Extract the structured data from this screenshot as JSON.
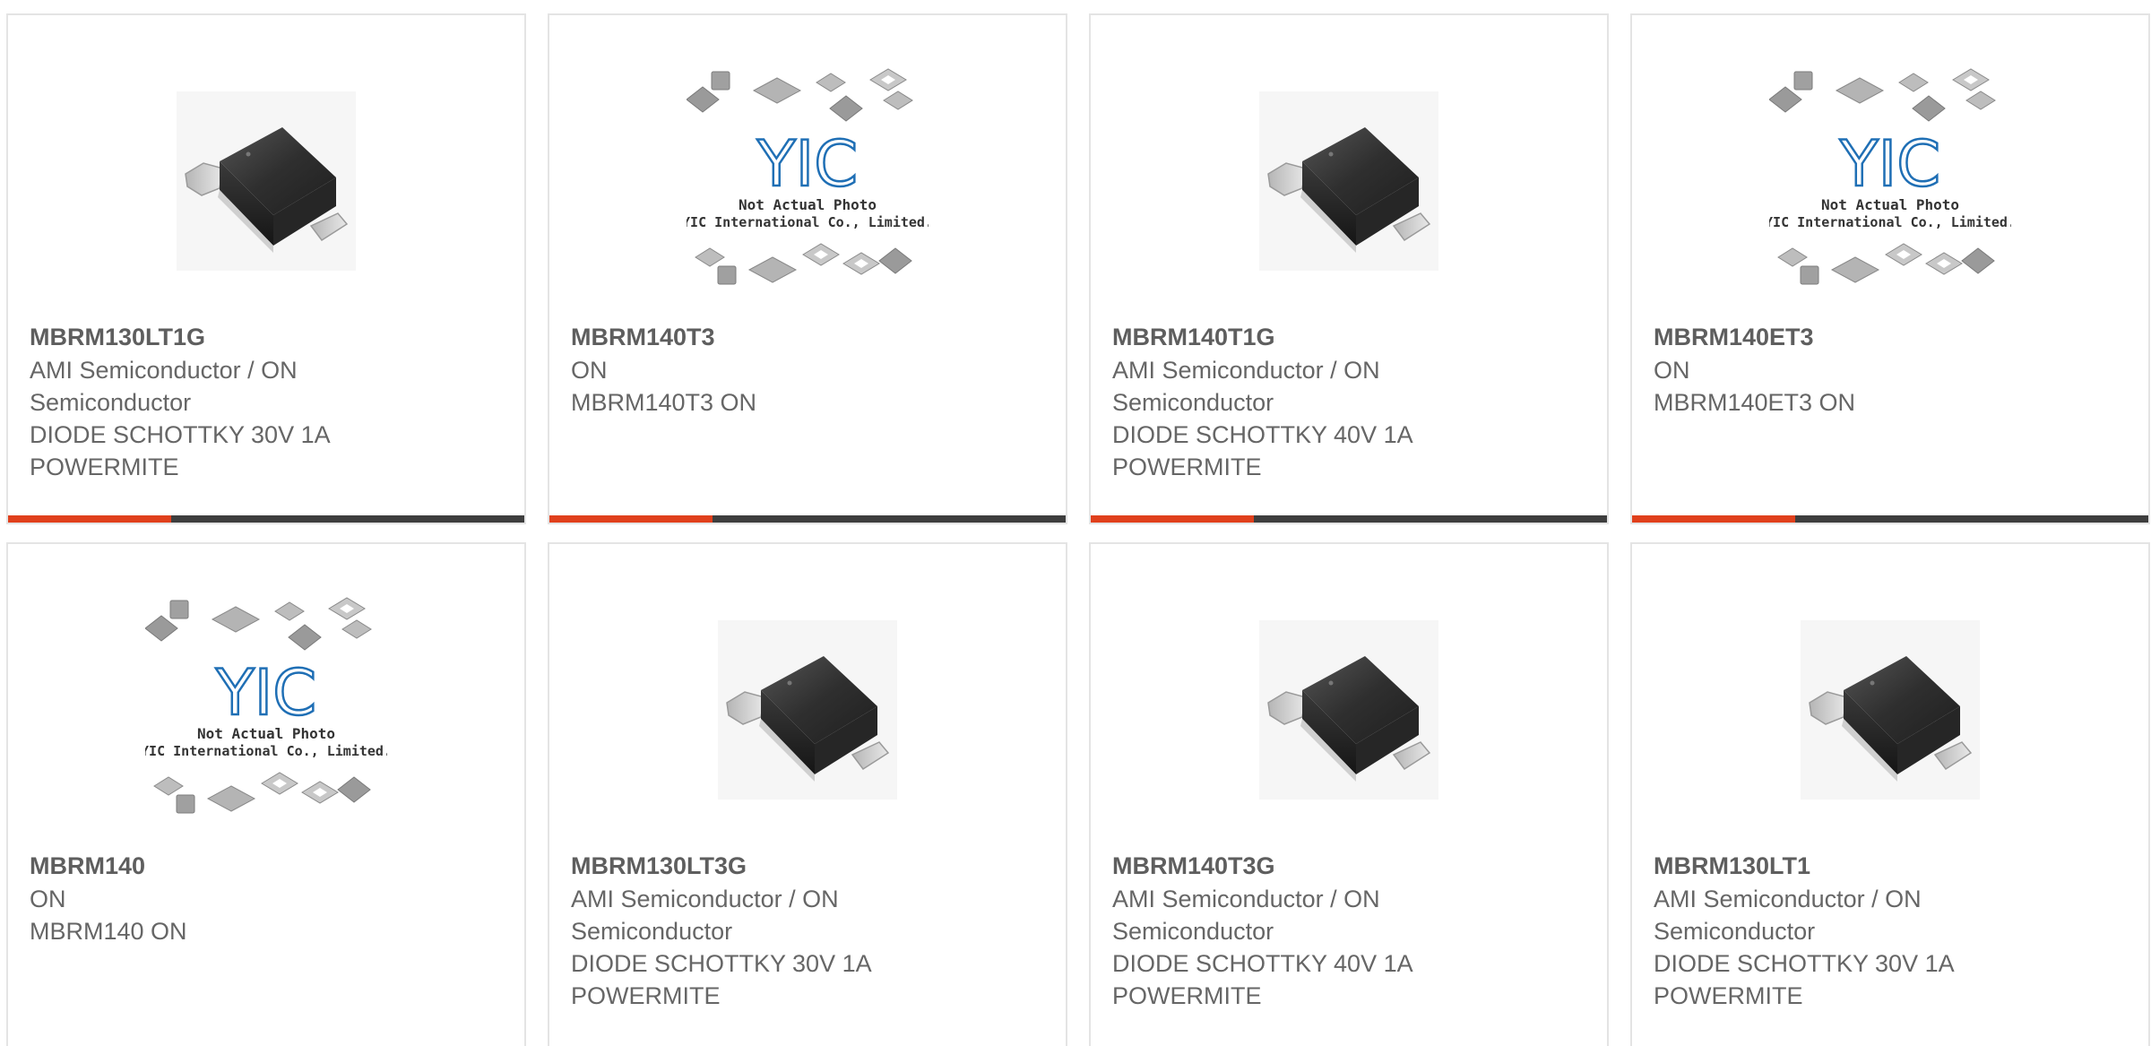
{
  "colors": {
    "accent": "#e0401c",
    "bar": "#3e3e3e",
    "border": "#e4e4e4",
    "text": "#666666"
  },
  "placeholder": {
    "line1": "Not Actual Photo",
    "line2": "YIC International Co., Limited.",
    "logo": "YIC"
  },
  "cards": [
    {
      "part": "MBRM130LT1G",
      "mfr_line1": "AMI Semiconductor / ON",
      "mfr_line2": "Semiconductor",
      "desc_line1": "DIODE SCHOTTKY 30V 1A",
      "desc_line2": "POWERMITE",
      "image": "diode-photo"
    },
    {
      "part": "MBRM140T3",
      "mfr_line1": "ON",
      "mfr_line2": "",
      "desc_line1": "MBRM140T3 ON",
      "desc_line2": "",
      "image": "placeholder"
    },
    {
      "part": "MBRM140T1G",
      "mfr_line1": "AMI Semiconductor / ON",
      "mfr_line2": "Semiconductor",
      "desc_line1": "DIODE SCHOTTKY 40V 1A",
      "desc_line2": "POWERMITE",
      "image": "diode-photo"
    },
    {
      "part": "MBRM140ET3",
      "mfr_line1": "ON",
      "mfr_line2": "",
      "desc_line1": "MBRM140ET3 ON",
      "desc_line2": "",
      "image": "placeholder"
    },
    {
      "part": "MBRM140",
      "mfr_line1": "ON",
      "mfr_line2": "",
      "desc_line1": "MBRM140 ON",
      "desc_line2": "",
      "image": "placeholder"
    },
    {
      "part": "MBRM130LT3G",
      "mfr_line1": "AMI Semiconductor / ON",
      "mfr_line2": "Semiconductor",
      "desc_line1": "DIODE SCHOTTKY 30V 1A",
      "desc_line2": "POWERMITE",
      "image": "diode-photo"
    },
    {
      "part": "MBRM140T3G",
      "mfr_line1": "AMI Semiconductor / ON",
      "mfr_line2": "Semiconductor",
      "desc_line1": "DIODE SCHOTTKY 40V 1A",
      "desc_line2": "POWERMITE",
      "image": "diode-photo"
    },
    {
      "part": "MBRM130LT1",
      "mfr_line1": "AMI Semiconductor / ON",
      "mfr_line2": "Semiconductor",
      "desc_line1": "DIODE SCHOTTKY 30V 1A",
      "desc_line2": "POWERMITE",
      "image": "diode-photo"
    }
  ]
}
